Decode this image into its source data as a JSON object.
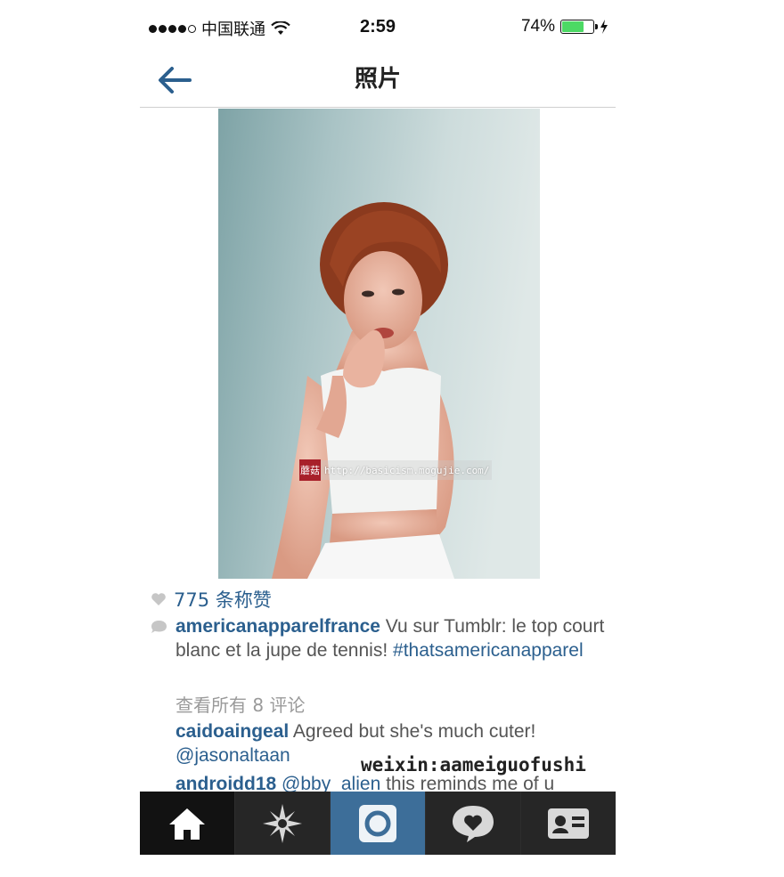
{
  "status_bar": {
    "carrier": "中国联通",
    "time": "2:59",
    "battery_percent": "74%",
    "battery_level": 0.74,
    "signal_bars": 4
  },
  "nav": {
    "title": "照片",
    "back_icon": "arrow-left-icon"
  },
  "photo": {
    "watermark_seal": "蘑菇",
    "watermark_url": "http://basicism.mogujie.com/"
  },
  "likes": {
    "text": "775 条称赞"
  },
  "caption": {
    "username": "americanapparelfrance",
    "text": " Vu sur Tumblr: le top court blanc et la jupe de tennis! ",
    "hashtag": "#thatsamericanapparel"
  },
  "comments": {
    "view_all": "查看所有 8 评论",
    "items": [
      {
        "username": "caidoaingeal",
        "text": " Agreed but she's much cuter! ",
        "mention": "@jasonaltaan"
      },
      {
        "username": "androidd18",
        "mention": " @bby_alien",
        "text": " this reminds me of u"
      }
    ]
  },
  "overlay_watermark": "weixin:aameiguofushi",
  "tab_bar": {
    "tabs": [
      "home-icon",
      "explore-icon",
      "camera-icon",
      "activity-icon",
      "profile-icon"
    ],
    "active": "home"
  },
  "colors": {
    "link_blue": "#2b5f8e",
    "tab_active_camera": "#3d6e99",
    "battery_green": "#4cd964"
  }
}
